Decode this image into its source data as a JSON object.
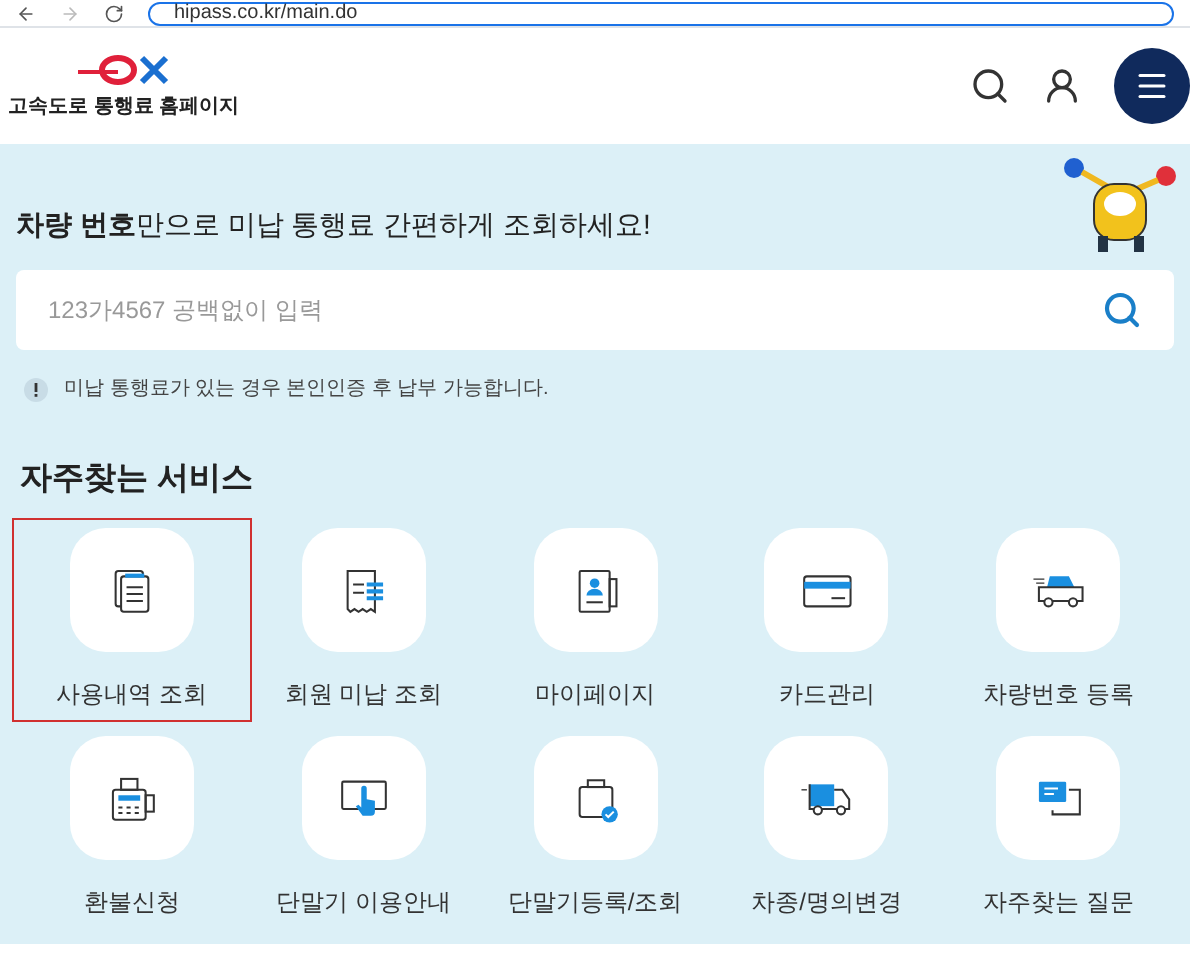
{
  "browser": {
    "url": "hipass.co.kr/main.do"
  },
  "header": {
    "site_name": "고속도로 통행료 홈페이지"
  },
  "hero": {
    "heading": "**차량 번호**만으로 미납 통행료 간편하게 조회하세요!",
    "search": {
      "placeholder": "123가4567 공백없이 입력"
    },
    "notice": "미납 통행료가 있는 경우 본인인증 후 납부 가능합니다."
  },
  "services": {
    "title": "자주찾는 서비스",
    "items": [
      {
        "label": "사용내역 조회",
        "kind": "documents",
        "selected": true
      },
      {
        "label": "회원 미납 조회",
        "kind": "receipt",
        "selected": false
      },
      {
        "label": "마이페이지",
        "kind": "profile",
        "selected": false
      },
      {
        "label": "카드관리",
        "kind": "card",
        "selected": false
      },
      {
        "label": "차량번호 등록",
        "kind": "car",
        "selected": false
      },
      {
        "label": "환불신청",
        "kind": "terminal",
        "selected": false
      },
      {
        "label": "단말기 이용안내",
        "kind": "touch",
        "selected": false
      },
      {
        "label": "단말기등록/조회",
        "kind": "device-check",
        "selected": false
      },
      {
        "label": "차종/명의변경",
        "kind": "truck",
        "selected": false
      },
      {
        "label": "자주찾는 질문",
        "kind": "chat",
        "selected": false
      }
    ]
  }
}
